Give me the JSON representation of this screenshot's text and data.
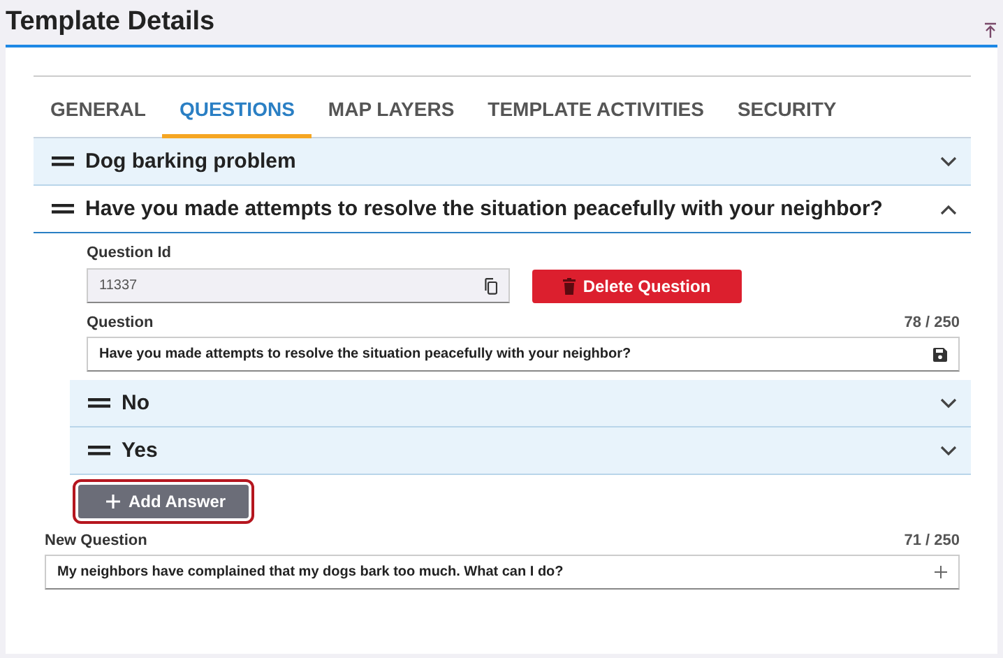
{
  "page": {
    "title": "Template Details"
  },
  "tabs": [
    {
      "label": "GENERAL",
      "selected": false
    },
    {
      "label": "QUESTIONS",
      "selected": true
    },
    {
      "label": "MAP LAYERS",
      "selected": false
    },
    {
      "label": "TEMPLATE ACTIVITIES",
      "selected": false
    },
    {
      "label": "SECURITY",
      "selected": false
    }
  ],
  "questions": [
    {
      "title": "Dog barking problem",
      "expanded": false
    },
    {
      "title": "Have you made attempts to resolve the situation peacefully with your neighbor?",
      "expanded": true,
      "id_label": "Question Id",
      "id_value": "11337",
      "delete_button": "Delete Question",
      "question_label": "Question",
      "question_count": "78 / 250",
      "question_value": "Have you made attempts to resolve the situation peacefully with your neighbor?",
      "answers": [
        {
          "title": "No",
          "expanded": false
        },
        {
          "title": "Yes",
          "expanded": false
        }
      ],
      "add_answer": {
        "label": "Add Answer",
        "focused": true
      }
    }
  ],
  "new_question": {
    "label": "New Question",
    "count": "71 / 250",
    "value": "My neighbors have complained that my dogs bark too much. What can I do?"
  }
}
